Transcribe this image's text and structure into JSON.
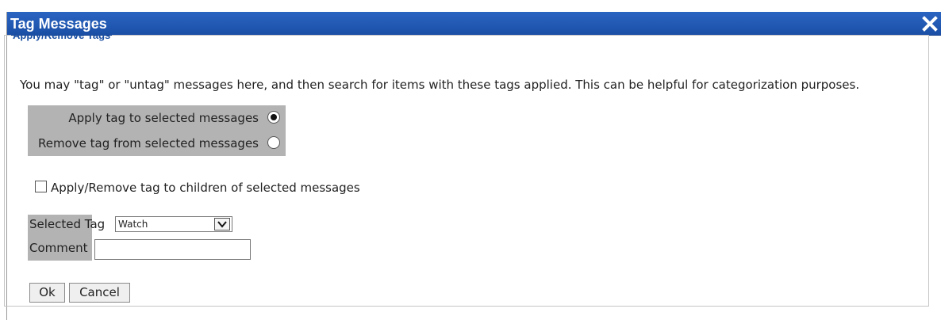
{
  "dialog": {
    "title": "Tag Messages",
    "close_icon": "close-icon",
    "accent_color": "#1f58b3"
  },
  "group": {
    "legend": "Apply/Remove Tags",
    "description": "You may \"tag\" or \"untag\" messages here, and then search for items with these tags applied. This can be helpful for categorization purposes."
  },
  "mode": {
    "options": [
      {
        "label": "Apply tag to selected messages",
        "checked": true
      },
      {
        "label": "Remove tag from selected messages",
        "checked": false
      }
    ]
  },
  "children_option": {
    "label": "Apply/Remove tag to children of selected messages",
    "checked": false
  },
  "fields": {
    "selected_tag_label": "Selected Tag",
    "selected_tag_value": "Watch",
    "comment_label": "Comment",
    "comment_value": ""
  },
  "buttons": {
    "ok": "Ok",
    "cancel": "Cancel"
  }
}
